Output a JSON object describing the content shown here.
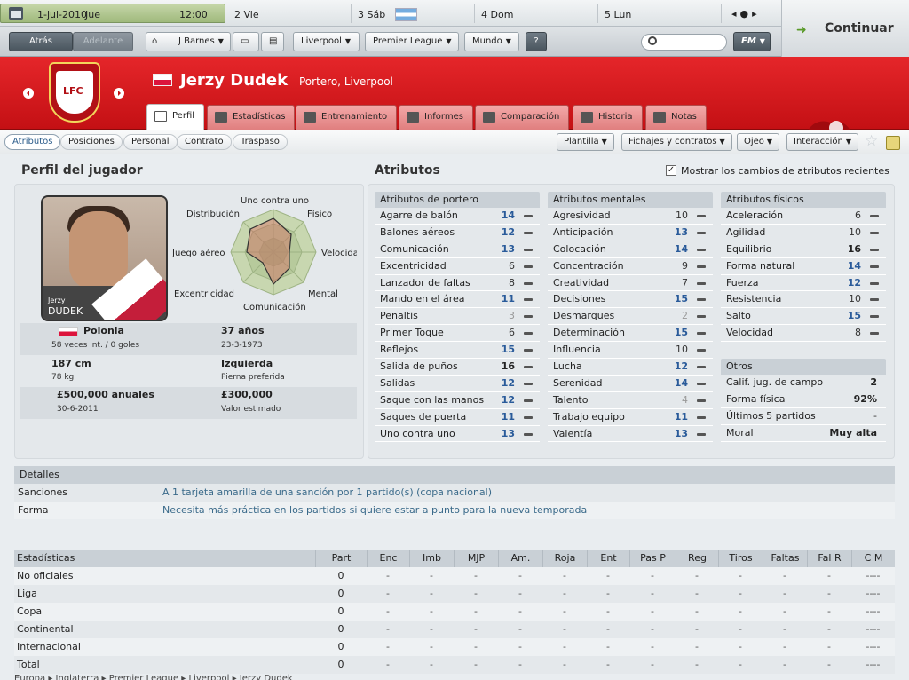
{
  "datebar": {
    "current_date": "1-jul-2010",
    "current_day": "Jue",
    "time": "12:00",
    "days": [
      "2 Vie",
      "3 Sáb",
      "4 Dom",
      "5 Lun"
    ],
    "continue_label": "Continuar"
  },
  "navbar": {
    "back": "Atrás",
    "forward": "Adelante",
    "manager": "J Barnes",
    "club": "Liverpool",
    "competition": "Premier League",
    "world": "Mundo",
    "help": "?",
    "search_placeholder": "",
    "fm_menu": "FM"
  },
  "player": {
    "name": "Jerzy Dudek",
    "role": "Portero, Liverpool",
    "photo_first_name": "Jerzy",
    "photo_last_name": "DUDEK"
  },
  "tabs": [
    {
      "label": "Perfil",
      "icon": "profile-icon"
    },
    {
      "label": "Estadísticas",
      "icon": "stats-icon"
    },
    {
      "label": "Entrenamiento",
      "icon": "training-icon"
    },
    {
      "label": "Informes",
      "icon": "reports-icon"
    },
    {
      "label": "Comparación",
      "icon": "comparison-icon"
    },
    {
      "label": "Historia",
      "icon": "history-icon"
    },
    {
      "label": "Notas",
      "icon": "notes-icon"
    }
  ],
  "subtabs": [
    "Atributos",
    "Posiciones",
    "Personal",
    "Contrato",
    "Traspaso"
  ],
  "actions": [
    "Plantilla",
    "Fichajes y contratos",
    "Ojeo",
    "Interacción"
  ],
  "profile": {
    "title": "Perfil del jugador",
    "radar_labels": {
      "top": "Uno contra uno",
      "top_left": "Distribución",
      "top_right": "Físico",
      "left": "Juego aéreo",
      "right": "Velocidad",
      "bottom_left": "Excentricidad",
      "bottom_right": "Mental",
      "bottom": "Comunicación"
    },
    "nationality": "Polonia",
    "caps": "58 veces int. / 0 goles",
    "age": "37 años",
    "dob": "23-3-1973",
    "height": "187 cm",
    "weight": "78 kg",
    "foot": "Izquierda",
    "foot_label": "Pierna preferida",
    "wage": "£500,000 anuales",
    "contract_end": "30-6-2011",
    "value": "£300,000",
    "value_label": "Valor estimado"
  },
  "attributes": {
    "title": "Atributos",
    "show_changes_label": "Mostrar los cambios de atributos recientes",
    "goalkeeping": {
      "header": "Atributos de portero",
      "rows": [
        {
          "name": "Agarre de balón",
          "value": "14",
          "style": "blue"
        },
        {
          "name": "Balones aéreos",
          "value": "12",
          "style": "blue"
        },
        {
          "name": "Comunicación",
          "value": "13",
          "style": "blue"
        },
        {
          "name": "Excentricidad",
          "value": "6",
          "style": ""
        },
        {
          "name": "Lanzador de faltas",
          "value": "8",
          "style": ""
        },
        {
          "name": "Mando en el área",
          "value": "11",
          "style": "blue"
        },
        {
          "name": "Penaltis",
          "value": "3",
          "style": "grey"
        },
        {
          "name": "Primer Toque",
          "value": "6",
          "style": ""
        },
        {
          "name": "Reflejos",
          "value": "15",
          "style": "blue"
        },
        {
          "name": "Salida de puños",
          "value": "16",
          "style": "bold"
        },
        {
          "name": "Salidas",
          "value": "12",
          "style": "blue"
        },
        {
          "name": "Saque con las manos",
          "value": "12",
          "style": "blue"
        },
        {
          "name": "Saques de puerta",
          "value": "11",
          "style": "blue"
        },
        {
          "name": "Uno contra uno",
          "value": "13",
          "style": "blue"
        }
      ]
    },
    "mental": {
      "header": "Atributos mentales",
      "rows": [
        {
          "name": "Agresividad",
          "value": "10",
          "style": ""
        },
        {
          "name": "Anticipación",
          "value": "13",
          "style": "blue"
        },
        {
          "name": "Colocación",
          "value": "14",
          "style": "blue"
        },
        {
          "name": "Concentración",
          "value": "9",
          "style": ""
        },
        {
          "name": "Creatividad",
          "value": "7",
          "style": ""
        },
        {
          "name": "Decisiones",
          "value": "15",
          "style": "blue"
        },
        {
          "name": "Desmarques",
          "value": "2",
          "style": "grey"
        },
        {
          "name": "Determinación",
          "value": "15",
          "style": "blue"
        },
        {
          "name": "Influencia",
          "value": "10",
          "style": ""
        },
        {
          "name": "Lucha",
          "value": "12",
          "style": "blue"
        },
        {
          "name": "Serenidad",
          "value": "14",
          "style": "blue"
        },
        {
          "name": "Talento",
          "value": "4",
          "style": "grey"
        },
        {
          "name": "Trabajo equipo",
          "value": "11",
          "style": "blue"
        },
        {
          "name": "Valentía",
          "value": "13",
          "style": "blue"
        }
      ]
    },
    "physical": {
      "header": "Atributos físicos",
      "rows": [
        {
          "name": "Aceleración",
          "value": "6",
          "style": ""
        },
        {
          "name": "Agilidad",
          "value": "10",
          "style": ""
        },
        {
          "name": "Equilibrio",
          "value": "16",
          "style": "bold"
        },
        {
          "name": "Forma natural",
          "value": "14",
          "style": "blue"
        },
        {
          "name": "Fuerza",
          "value": "12",
          "style": "blue"
        },
        {
          "name": "Resistencia",
          "value": "10",
          "style": ""
        },
        {
          "name": "Salto",
          "value": "15",
          "style": "blue"
        },
        {
          "name": "Velocidad",
          "value": "8",
          "style": ""
        }
      ]
    },
    "others": {
      "header": "Otros",
      "rows": [
        {
          "name": "Calif. jug. de campo",
          "value": "2"
        },
        {
          "name": "Forma física",
          "value": "92%"
        },
        {
          "name": "Últimos 5 partidos",
          "value": "-"
        },
        {
          "name": "Moral",
          "value": "Muy alta"
        }
      ]
    }
  },
  "details": {
    "header": "Detalles",
    "rows": [
      {
        "key": "Sanciones",
        "value": "A 1 tarjeta amarilla de una sanción por 1 partido(s) (copa nacional)"
      },
      {
        "key": "Forma",
        "value": "Necesita más práctica en los partidos si quiere estar a punto para la nueva temporada"
      }
    ]
  },
  "stats": {
    "columns": [
      "Estadísticas",
      "Part",
      "Enc",
      "Imb",
      "MJP",
      "Am.",
      "Roja",
      "Ent",
      "Pas P",
      "Reg",
      "Tiros",
      "Faltas",
      "Fal R",
      "C M"
    ],
    "rows": [
      [
        "No oficiales",
        "0",
        "-",
        "-",
        "-",
        "-",
        "-",
        "-",
        "-",
        "-",
        "-",
        "-",
        "-",
        "----"
      ],
      [
        "Liga",
        "0",
        "-",
        "-",
        "-",
        "-",
        "-",
        "-",
        "-",
        "-",
        "-",
        "-",
        "-",
        "----"
      ],
      [
        "Copa",
        "0",
        "-",
        "-",
        "-",
        "-",
        "-",
        "-",
        "-",
        "-",
        "-",
        "-",
        "-",
        "----"
      ],
      [
        "Continental",
        "0",
        "-",
        "-",
        "-",
        "-",
        "-",
        "-",
        "-",
        "-",
        "-",
        "-",
        "-",
        "----"
      ],
      [
        "Internacional",
        "0",
        "-",
        "-",
        "-",
        "-",
        "-",
        "-",
        "-",
        "-",
        "-",
        "-",
        "-",
        "----"
      ],
      [
        "Total",
        "0",
        "-",
        "-",
        "-",
        "-",
        "-",
        "-",
        "-",
        "-",
        "-",
        "-",
        "-",
        "----"
      ]
    ]
  },
  "breadcrumb": [
    "Europa",
    "Inglaterra",
    "Premier League",
    "Liverpool",
    "Jerzy Dudek"
  ],
  "colors": {
    "club_red": "#c41014",
    "attr_blue": "#2a5b9a"
  }
}
